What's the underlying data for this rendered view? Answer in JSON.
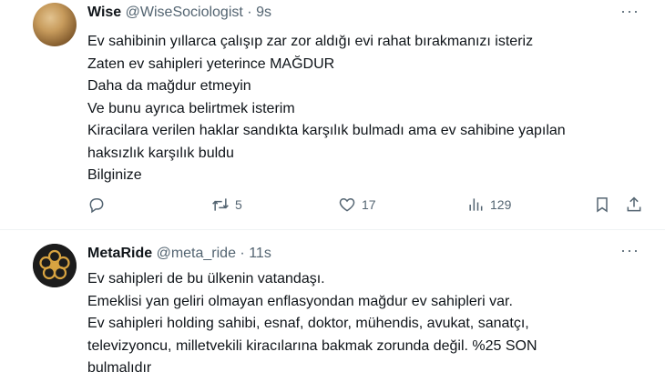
{
  "tweets": [
    {
      "display_name": "Wise",
      "handle": "@WiseSociologist",
      "separator": "·",
      "time": "9s",
      "more": "···",
      "lines": [
        "Ev sahibinin yıllarca çalışıp zar zor aldığı evi rahat bırakmanızı isteriz",
        "Zaten ev sahipleri yeterince MAĞDUR",
        "Daha da mağdur etmeyin",
        "Ve bunu ayrıca belirtmek isterim",
        "Kiracilara verilen haklar sandıkta karşılık bulmadı ama ev sahibine yapılan",
        "haksızlık karşılık buldu",
        "Bilginize"
      ],
      "actions": {
        "reply_count": "",
        "retweet_count": "5",
        "like_count": "17",
        "views_count": "129"
      }
    },
    {
      "display_name": "MetaRide",
      "handle": "@meta_ride",
      "separator": "·",
      "time": "11s",
      "more": "···",
      "lines": [
        "Ev sahipleri de bu ülkenin vatandaşı.",
        "Emeklisi yan geliri olmayan enflasyondan mağdur ev sahipleri var.",
        "Ev sahipleri holding sahibi, esnaf, doktor, mühendis, avukat, sanatçı,",
        "televizyoncu, milletvekili kiracılarına bakmak zorunda değil. %25 SON",
        "bulmalıdır"
      ]
    }
  ],
  "colors": {
    "text": "#0f1419",
    "secondary": "#536471",
    "divider": "#eff3f4"
  }
}
